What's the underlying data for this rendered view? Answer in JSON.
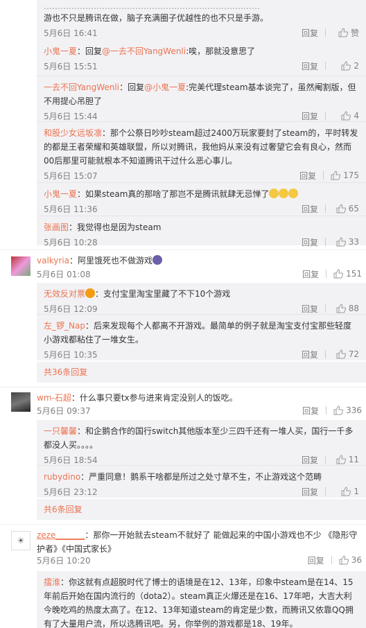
{
  "top_fragment": {
    "text": "游也不只是腾讯在做，脑子充满圈子优越性的也不只是手游。",
    "time": "5月6日 16:41",
    "reply_label": "回复",
    "like_label": "赞"
  },
  "thread1": [
    {
      "user": "小鬼一夏",
      "prefix": "：回复",
      "at": "@一去不回YangWenli",
      "text": ":唉，那就没意思了",
      "time": "5月6日 15:51",
      "likes": "2"
    },
    {
      "user": "一去不回YangWenli",
      "prefix": "：回复",
      "at": "@小鬼一夏",
      "text": ":完美代理steam基本谈完了，虽然阉割版，但不用提心吊胆了",
      "time": "5月6日 15:44",
      "likes": "4"
    },
    {
      "user": "和股少女远坂凛",
      "prefix": "",
      "at": "",
      "text": "：那个公祭日吵吵steam超过2400万玩家要封了steam的，平时转发的都是王者荣耀和英雄联盟，所以对腾讯，我他妈从来没有过奢望它会有良心，然而00后那里可能就根本不知道腾讯干过什么恶心事儿。",
      "time": "5月6日 15:07",
      "likes": "175"
    },
    {
      "user": "小鬼一夏",
      "prefix": "",
      "at": "",
      "text": "：如果steam真的那啥了那岂不是腾讯就肆无忌惮了",
      "time": "5月6日 11:36",
      "likes": "65"
    },
    {
      "user": "张画图",
      "prefix": "",
      "at": "",
      "text": "：我觉得也是因为steam",
      "time": "5月6日 10:28",
      "likes": "33"
    }
  ],
  "comment_valkyria": {
    "user": "valkyria",
    "text": "：阿里饿死也不做游戏",
    "time": "5月6日 01:08",
    "likes": "151"
  },
  "thread2": [
    {
      "user": "无效反对票",
      "text": "：支付宝里淘宝里藏了不下10个游戏",
      "time": "5月6日 12:09",
      "likes": "88"
    },
    {
      "user": "左_锣_Nap",
      "text": "：后来发现每个人都离不开游戏。最简单的例子就是淘宝支付宝那些轻度小游戏都粘住了一堆女生。",
      "time": "5月6日 10:35",
      "likes": "72"
    }
  ],
  "more1": "共36条回复",
  "comment_wm": {
    "user": "wm-石超",
    "text": "：什么事只要tx参与进来肯定没别人的饭吃。",
    "time": "5月6日 09:37",
    "likes": "336"
  },
  "thread3": [
    {
      "user": "一只馨馨",
      "text": "：和企鹅合作的国行switch其他版本至少三四千还有一堆人买，国行一千多都没人买。。。。",
      "time": "5月6日 18:54",
      "likes": "11"
    },
    {
      "user": "rubydino",
      "text": "：严重同意！鹅系干啥都是所过之处寸草不生，不止游戏这个范畴",
      "time": "5月6日 23:12",
      "likes": "1"
    }
  ],
  "more2": "共6条回复",
  "comment_zeze": {
    "user": "zeze_______",
    "text": "：那你一开始就去steam不就好了 能做起来的中国小游戏也不少 《隐形守护者》《中国式家长》",
    "time": "5月6日 10:20",
    "likes": "36"
  },
  "thread4": [
    {
      "user": "擂淮",
      "text": "：你这就有点超脱时代了博士的语境是在12、13年，印象中steam是在14、15年前后开始在国内流行的（dota2）。steam真正火爆还是在16、17年吧，大吉大利今晚吃鸡的热度太高了。在12、13年知道steam的肯定是少数，而腾讯又依靠QQ拥有了大量用户流，所以选腾讯吧。另，你举例的游戏都是18、19年。"
    }
  ],
  "labels": {
    "reply": "回复"
  },
  "colors": {
    "link": "#eb7350",
    "meta": "#808080",
    "reply_bg": "#f2f2f5"
  }
}
